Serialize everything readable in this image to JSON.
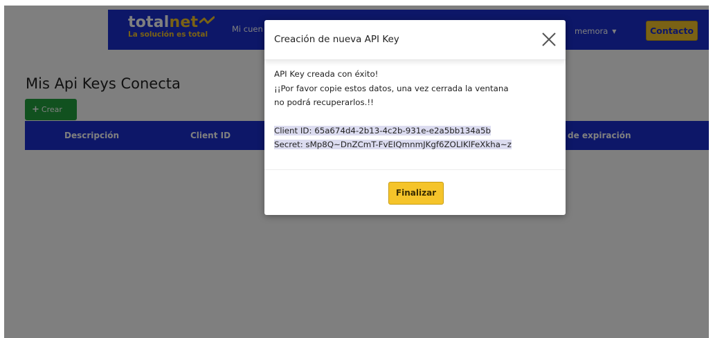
{
  "header": {
    "logo_total": "total",
    "logo_net": "net",
    "tagline": "La solución es total",
    "nav_partial": "Mi cuen",
    "user_menu": "memora",
    "contact_label": "Contacto"
  },
  "page": {
    "title": "Mis Api Keys Conecta",
    "create_label": "Crear",
    "columns": [
      "Descripción",
      "Client ID",
      "de expiración"
    ]
  },
  "modal": {
    "title": "Creación de nueva API Key",
    "close_symbol": "×",
    "success": "API Key creada con éxito!",
    "warning_line1": "¡¡Por favor copie estos datos, una vez cerrada la ventana",
    "warning_line2": "no podrá recuperarlos.!!",
    "client_id": "Client ID: 65a674d4-2b13-4c2b-931e-e2a5bb134a5b",
    "secret": "Secret: sMp8Q~DnZCmT-FvEIQmnmJKgf6ZOLIKlFeXkha~z",
    "finish_label": "Finalizar"
  },
  "colors": {
    "brand_blue": "#1b2fd1",
    "accent_yellow": "#f5c42a",
    "success_green": "#23a33f",
    "selection": "#dcdcf0"
  }
}
